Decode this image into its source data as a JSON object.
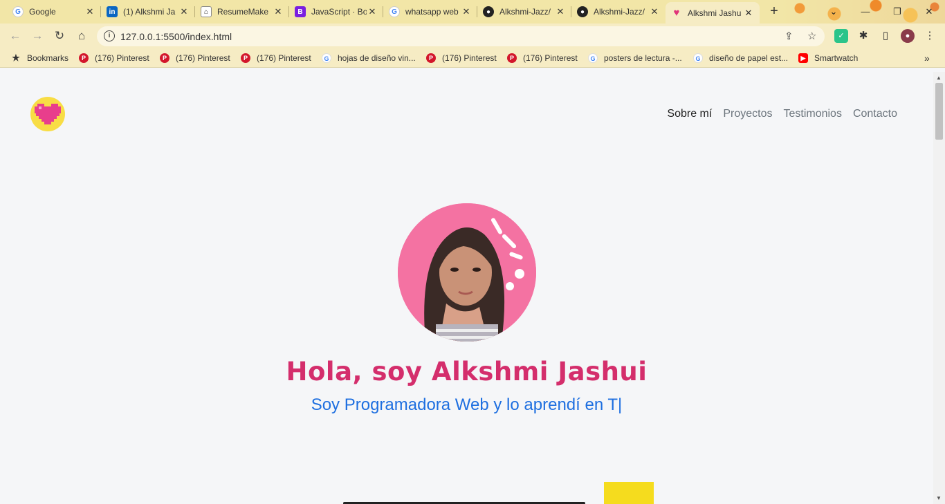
{
  "tabs": [
    {
      "title": "Google",
      "favicon": "google-icon",
      "active": false
    },
    {
      "title": "(1) Alkshmi Ja",
      "favicon": "linkedin-icon",
      "active": false
    },
    {
      "title": "ResumeMake",
      "favicon": "resume-icon",
      "active": false
    },
    {
      "title": "JavaScript · Bo",
      "favicon": "bootstrap-icon",
      "active": false
    },
    {
      "title": "whatsapp web",
      "favicon": "google-icon",
      "active": false
    },
    {
      "title": "Alkshmi-Jazz/",
      "favicon": "github-icon",
      "active": false
    },
    {
      "title": "Alkshmi-Jazz/",
      "favicon": "github-icon",
      "active": false
    },
    {
      "title": "Alkshmi Jashu",
      "favicon": "heart-icon",
      "active": true
    }
  ],
  "address": {
    "url": "127.0.0.1:5500/index.html"
  },
  "bookmarks": [
    {
      "label": "Bookmarks",
      "icon": "star-icon"
    },
    {
      "label": "(176) Pinterest",
      "icon": "pinterest-icon"
    },
    {
      "label": "(176) Pinterest",
      "icon": "pinterest-icon"
    },
    {
      "label": "(176) Pinterest",
      "icon": "pinterest-icon"
    },
    {
      "label": "hojas de diseño vin...",
      "icon": "google-icon"
    },
    {
      "label": "(176) Pinterest",
      "icon": "pinterest-icon"
    },
    {
      "label": "(176) Pinterest",
      "icon": "pinterest-icon"
    },
    {
      "label": "posters de lectura -...",
      "icon": "google-icon"
    },
    {
      "label": "diseño de papel est...",
      "icon": "google-icon"
    },
    {
      "label": "Smartwatch",
      "icon": "youtube-icon"
    }
  ],
  "site": {
    "nav": [
      "Sobre mí",
      "Proyectos",
      "Testimonios",
      "Contacto"
    ],
    "hero_title": "Hola, soy Alkshmi Jashui",
    "hero_subtitle": "Soy Programadora Web y lo aprendí en T|"
  },
  "colors": {
    "accent_pink": "#d42e6c",
    "accent_blue": "#1e6fe0",
    "logo_yellow": "#f8dd45"
  }
}
